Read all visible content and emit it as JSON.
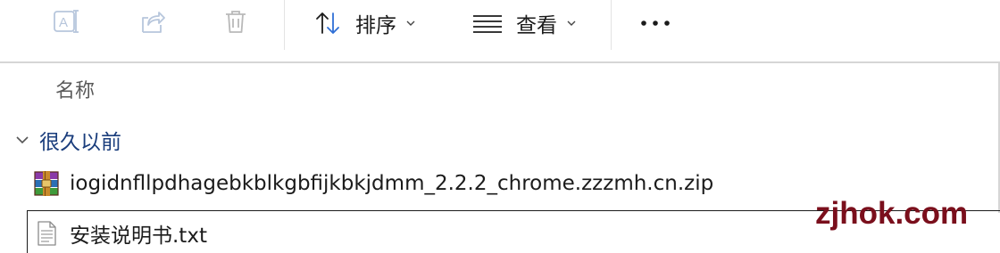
{
  "toolbar": {
    "sort_label": "排序",
    "view_label": "查看",
    "icons": [
      "rename-icon",
      "share-icon",
      "delete-icon",
      "sort-icon",
      "view-icon",
      "more-icon"
    ]
  },
  "columns": {
    "name_header": "名称"
  },
  "groups": [
    {
      "label": "很久以前",
      "expanded": true,
      "items": [
        {
          "name": "iogidnfllpdhagebkblkgbfijkbkjdmm_2.2.2_chrome.zzzmh.cn.zip",
          "icon": "winrar-archive-icon",
          "selected": false
        },
        {
          "name": "安装说明书.txt",
          "icon": "text-file-icon",
          "selected": true
        }
      ]
    }
  ],
  "watermark": {
    "text": "zjhok.com",
    "color": "#7a0f1c"
  }
}
